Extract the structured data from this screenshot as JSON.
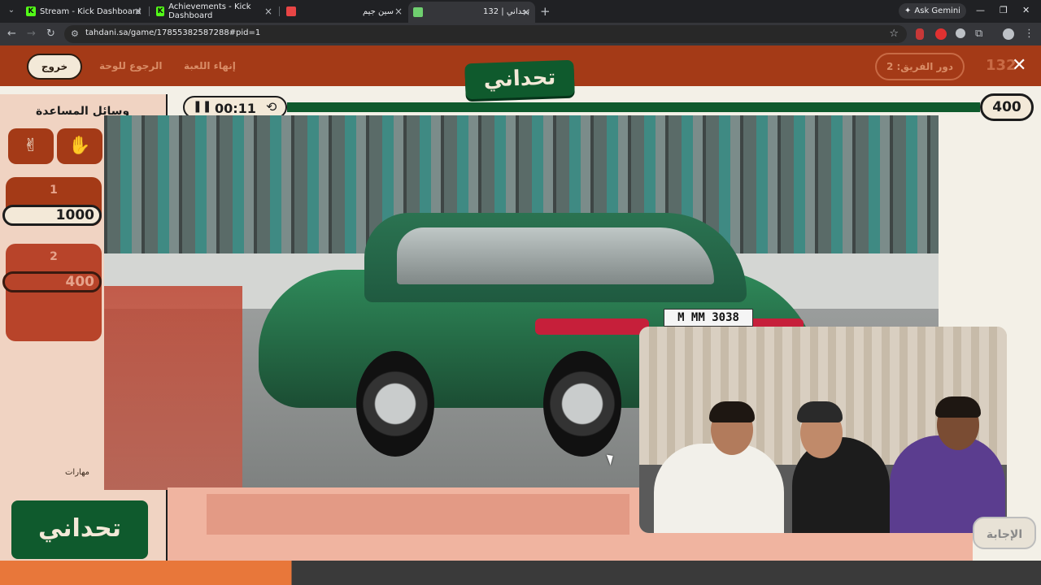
{
  "browser": {
    "tabs": [
      {
        "title": "Stream - Kick Dashboard",
        "favicon": "K",
        "color": "#53fc18"
      },
      {
        "title": "Achievements - Kick Dashboard",
        "favicon": "K",
        "color": "#53fc18"
      },
      {
        "title": "سين جيم",
        "favicon": "",
        "color": "#e84545"
      },
      {
        "title": "132 | تحداني",
        "favicon": "",
        "color": "#6fcf6f"
      }
    ],
    "ask_gemini": "Ask Gemini",
    "url": "tahdani.sa/game/17855382587288#pid=1"
  },
  "header": {
    "exit_label": "خروج",
    "back_to_board": "الرجوع للوحة",
    "end_game": "إنهاء اللعبة",
    "logo_text": "تحداني",
    "team_turn": "دور الفريق: 2",
    "question_number": "132",
    "close_symbol": "✕"
  },
  "sidebar": {
    "help_title": "وسائل المساعدة",
    "help_icons": [
      "✌",
      "✋"
    ],
    "teams": [
      {
        "name": "1",
        "score": "1000"
      },
      {
        "name": "2",
        "score": "400"
      }
    ],
    "extra_label": "مهارات",
    "logo_text": "تحداني"
  },
  "timer": {
    "time": "00:11",
    "points": "400"
  },
  "question": {
    "plate_text": "M MM 3038"
  },
  "actions": {
    "skip_label": "الإجابة"
  }
}
